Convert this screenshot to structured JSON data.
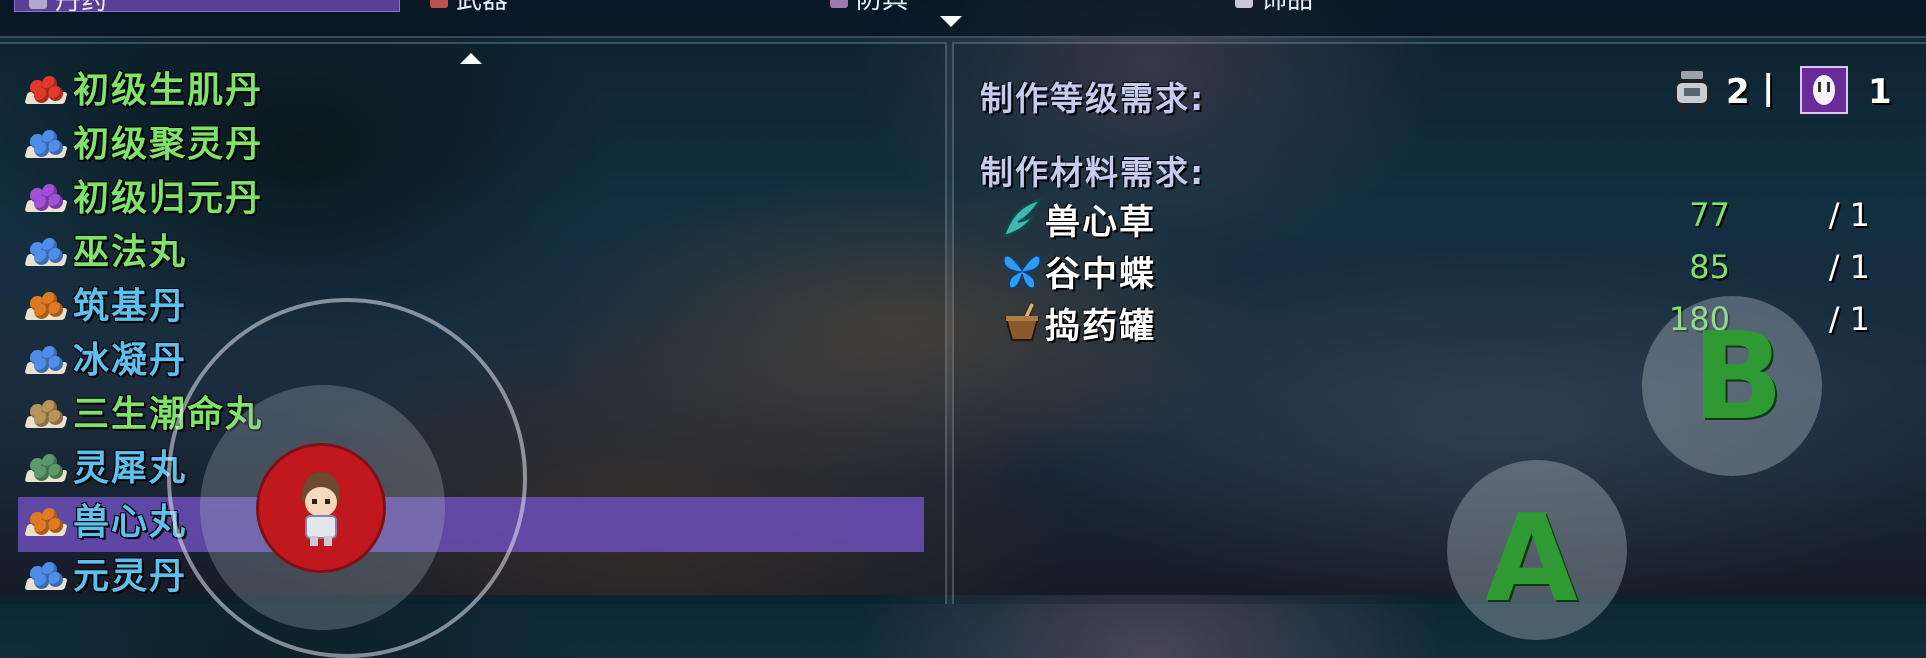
{
  "tabs": [
    {
      "label": "丹药",
      "active": true
    },
    {
      "label": "武器"
    },
    {
      "label": "防具"
    },
    {
      "label": "饰品"
    }
  ],
  "recipe_list": [
    {
      "name": "初级生肌丹",
      "pill_color": "#e23a2a",
      "text_color": "#7fe26b"
    },
    {
      "name": "初级聚灵丹",
      "pill_color": "#4f8ee8",
      "text_color": "#7fe26b"
    },
    {
      "name": "初级归元丹",
      "pill_color": "#a34fd6",
      "text_color": "#7fe26b"
    },
    {
      "name": "巫法丸",
      "pill_color": "#4f8ee8",
      "text_color": "#7fe26b"
    },
    {
      "name": "筑基丹",
      "pill_color": "#e07a22",
      "text_color": "#5ec0ee"
    },
    {
      "name": "冰凝丹",
      "pill_color": "#4f8ee8",
      "text_color": "#5ec0ee"
    },
    {
      "name": "三生潮命丸",
      "pill_color": "#b8955a",
      "text_color": "#7fe26b"
    },
    {
      "name": "灵犀丸",
      "pill_color": "#5a9a6a",
      "text_color": "#5ec0ee"
    },
    {
      "name": "兽心丸",
      "pill_color": "#e07a22",
      "text_color": "#5ec0ee",
      "selected": true
    },
    {
      "name": "元灵丹",
      "pill_color": "#4f8ee8",
      "text_color": "#5ec0ee"
    }
  ],
  "requirements": {
    "level_label": "制作等级需求:",
    "level_values": [
      "2",
      "1"
    ],
    "separator": "|",
    "material_label": "制作材料需求:",
    "materials": [
      {
        "name": "兽心草",
        "icon": "herb-icon",
        "have": "77",
        "need": "/ 1"
      },
      {
        "name": "谷中蝶",
        "icon": "butterfly-icon",
        "have": "85",
        "need": "/ 1"
      },
      {
        "name": "捣药罐",
        "icon": "mortar-icon",
        "have": "180",
        "need": "/ 1"
      }
    ]
  },
  "controls": {
    "a_label": "A",
    "b_label": "B"
  }
}
